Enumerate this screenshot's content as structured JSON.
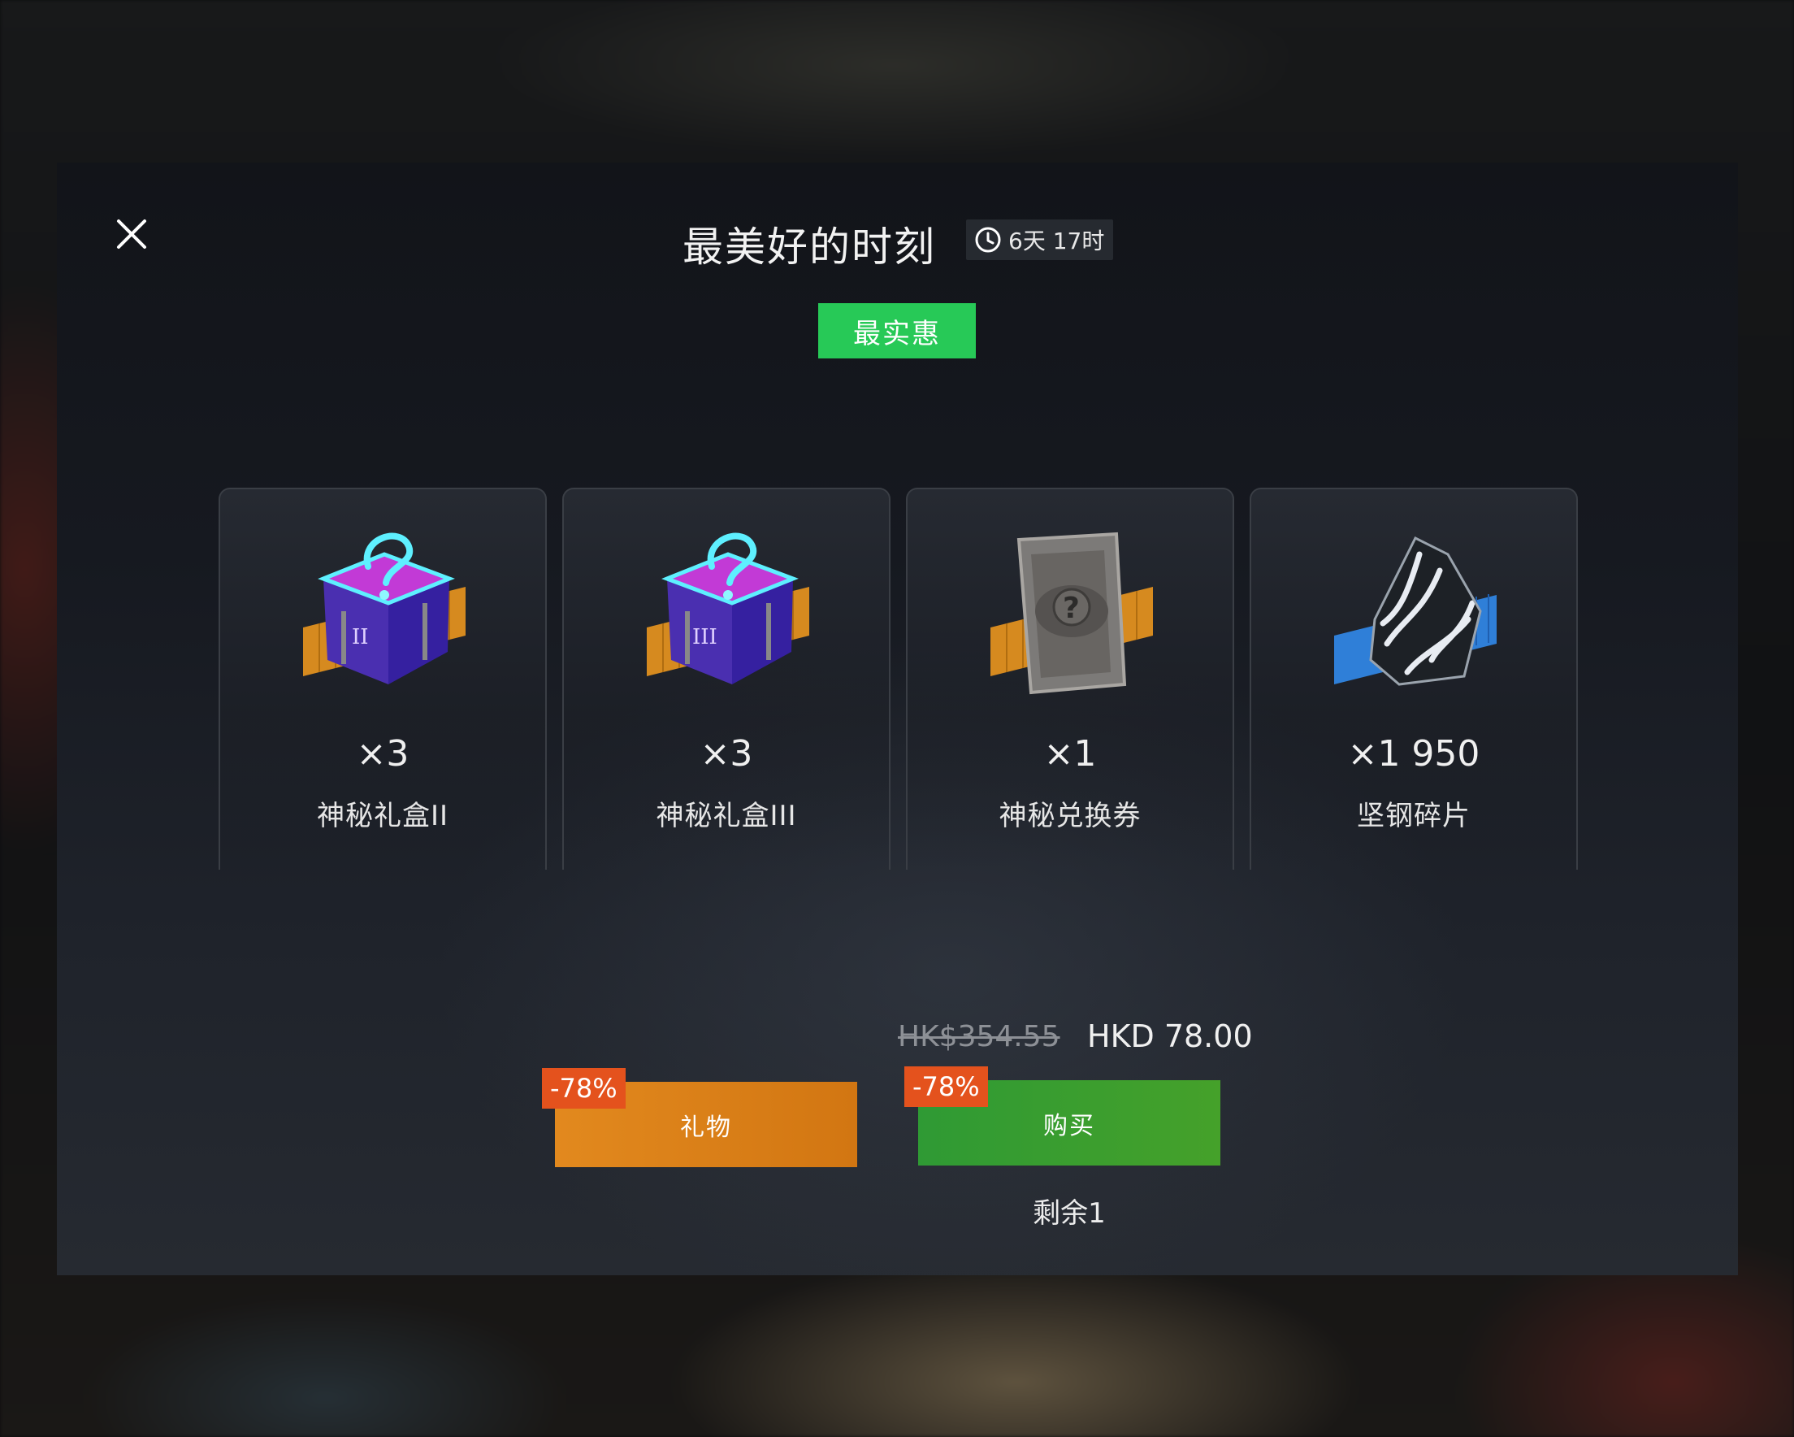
{
  "offer": {
    "title": "最美好的时刻",
    "timer": "6天 17时",
    "best_label": "最实惠"
  },
  "items": [
    {
      "qty": "×3",
      "name": "神秘礼盒II",
      "icon": "mystery-box-icon",
      "stripe_color": "#d68a1f"
    },
    {
      "qty": "×3",
      "name": "神秘礼盒III",
      "icon": "mystery-box-icon",
      "stripe_color": "#d68a1f"
    },
    {
      "qty": "×1",
      "name": "神秘兑换券",
      "icon": "exchange-voucher-icon",
      "stripe_color": "#d68a1f"
    },
    {
      "qty": "×1 950",
      "name": "坚钢碎片",
      "icon": "steel-shard-icon",
      "stripe_color": "#2f7fd8"
    }
  ],
  "price": {
    "original": "HK$354.55",
    "current": "HKD 78.00"
  },
  "actions": {
    "gift_label": "礼物",
    "buy_label": "购买",
    "discount": "-78%",
    "remaining": "剩余1"
  },
  "colors": {
    "best_badge": "#27c957",
    "gift_button": "#da8018",
    "buy_button": "#3a9e2f",
    "discount_badge": "#e4521d"
  }
}
